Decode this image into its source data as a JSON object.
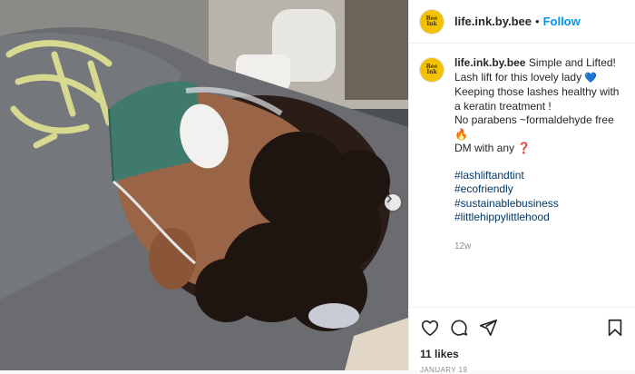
{
  "post": {
    "username": "life.ink.by.bee",
    "avatar_text": "Bee Ink",
    "follow_label": "Follow",
    "separator": "•",
    "caption": {
      "lines": [
        "Simple and Lifted!",
        "Lash lift for this lovely lady",
        "Keeping those lashes healthy with a keratin treatment !",
        "No parabens ~formaldehyde free",
        "DM with any"
      ],
      "emoji_heart": "💙",
      "emoji_fire": "🔥",
      "emoji_question": "❓"
    },
    "hashtags": [
      "#lashliftandtint",
      "#ecofriendly",
      "#sustainablebusiness",
      "#littlehippylittlehood"
    ],
    "time_ago": "12w",
    "likes": "11 likes",
    "date": "January 19",
    "icons": [
      "heart-icon",
      "comment-icon",
      "share-icon",
      "bookmark-icon",
      "chevron-right-icon"
    ]
  }
}
